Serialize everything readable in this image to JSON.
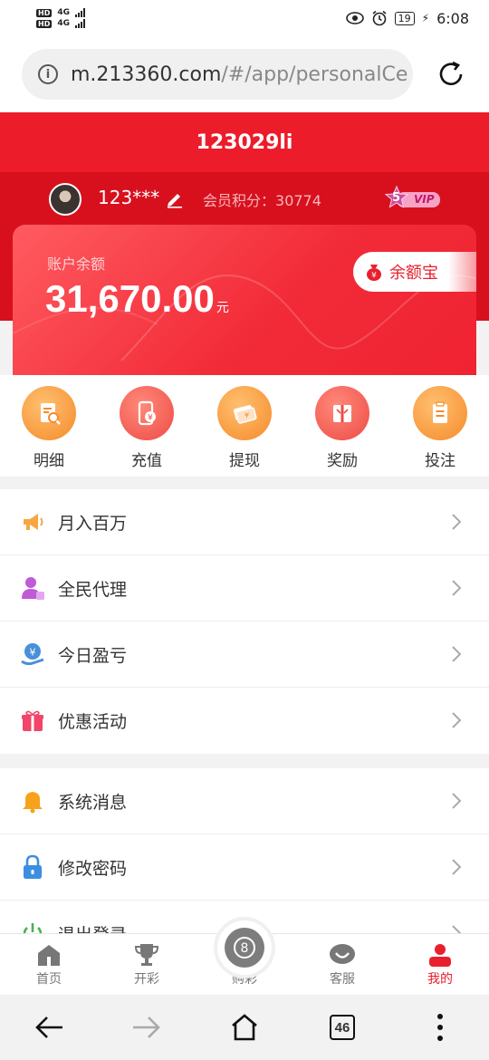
{
  "status_bar": {
    "net1": "4G",
    "net2": "4G",
    "battery": "19",
    "time": "6:08"
  },
  "browser": {
    "url_host": "m.213360.com",
    "url_path": "/#/app/personalCe"
  },
  "header": {
    "title": "123029li"
  },
  "user": {
    "name": "123***",
    "points_label": "会员积分：",
    "points_value": "30774",
    "vip_level": "5",
    "vip_text": "VIP"
  },
  "balance": {
    "label": "账户余额",
    "value": "31,670.00",
    "unit": "元",
    "yeb_label": "余额宝"
  },
  "quick_actions": [
    {
      "label": "明细"
    },
    {
      "label": "充值"
    },
    {
      "label": "提现"
    },
    {
      "label": "奖励"
    },
    {
      "label": "投注"
    }
  ],
  "menu_group_1": [
    {
      "label": "月入百万"
    },
    {
      "label": "全民代理"
    },
    {
      "label": "今日盈亏"
    },
    {
      "label": "优惠活动"
    }
  ],
  "menu_group_2": [
    {
      "label": "系统消息"
    },
    {
      "label": "修改密码"
    },
    {
      "label": "退出登录"
    }
  ],
  "tab_bar": [
    {
      "label": "首页"
    },
    {
      "label": "开彩"
    },
    {
      "label": "购彩"
    },
    {
      "label": "客服"
    },
    {
      "label": "我的"
    }
  ],
  "system_nav": {
    "tab_count": "46"
  },
  "colors": {
    "brand_red": "#ec1c2b",
    "dark_red": "#d8101e",
    "orange": "#f58a2a"
  }
}
